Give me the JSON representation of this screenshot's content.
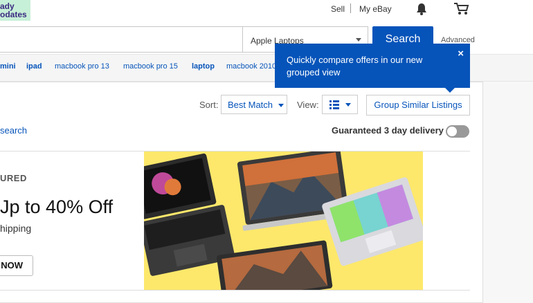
{
  "header": {
    "promo_line1": "ady",
    "promo_line2": "odates",
    "sell": "Sell",
    "my_ebay": "My eBay",
    "bell_icon": "bell-icon",
    "cart_icon": "cart-icon"
  },
  "search": {
    "query": "",
    "category": "Apple Laptops",
    "button": "Search",
    "advanced": "Advanced"
  },
  "related": [
    "mini",
    "ipad",
    "macbook pro 13",
    "macbook pro 15",
    "laptop",
    "macbook 2010"
  ],
  "toolbar": {
    "sort_label": "Sort:",
    "sort_value": "Best Match",
    "view_label": "View:",
    "group_button": "Group Similar Listings",
    "save_search": "search",
    "guaranteed": "Guaranteed 3 day delivery"
  },
  "tooltip": {
    "text": "Quickly compare offers in our new grouped view",
    "close": "×"
  },
  "featured": {
    "tag": "URED",
    "headline": "Jp to 40% Off",
    "sub": "hipping",
    "button": "NOW"
  },
  "colors": {
    "brand_blue": "#0654ba",
    "banner_yellow": "#fde86b"
  }
}
